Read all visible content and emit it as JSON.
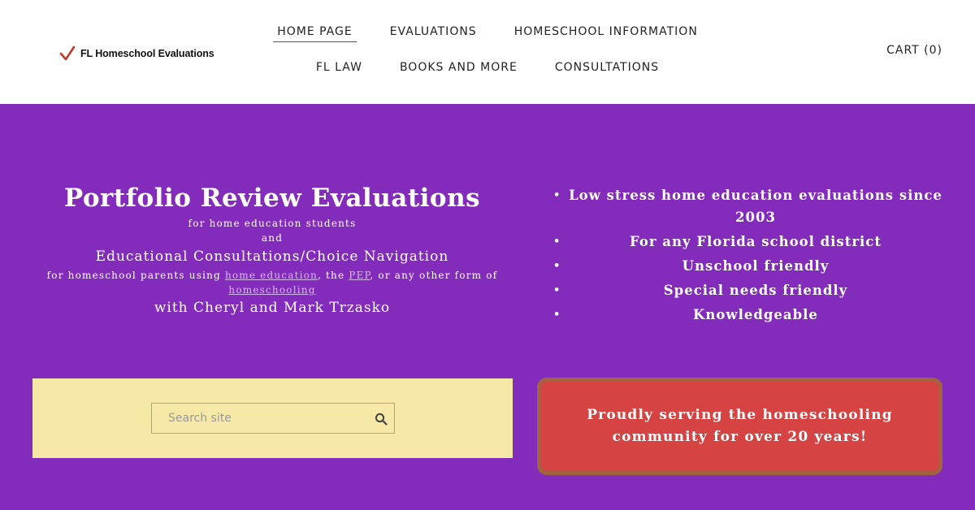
{
  "header": {
    "logo_text": "FL Homeschool Evaluations",
    "nav_row1": [
      {
        "label": "HOME PAGE",
        "active": true
      },
      {
        "label": "EVALUATIONS",
        "active": false
      },
      {
        "label": "HOMESCHOOL INFORMATION",
        "active": false
      }
    ],
    "nav_row2": [
      {
        "label": "FL LAW",
        "active": false
      },
      {
        "label": "BOOKS AND MORE",
        "active": false
      },
      {
        "label": "CONSULTATIONS",
        "active": false
      }
    ],
    "cart": "CART (0)"
  },
  "hero": {
    "title": "Portfolio Review Evaluations",
    "line1": "for home education students",
    "line2": "and",
    "line3": "Educational Consultations/Choice Navigation",
    "line4_prefix": "for homeschool parents using ",
    "link_home_education": "home education",
    "line4_mid1": ", the ",
    "link_pep": "PEP",
    "line4_mid2": ", or any other form of ",
    "link_homeschooling": "homeschooling",
    "people": "with Cheryl and Mark Trzasko",
    "bullets": [
      "Low stress home education evaluations since 2003",
      "For any Florida school district",
      "Unschool friendly",
      "Special needs friendly",
      "Knowledgeable"
    ]
  },
  "search": {
    "placeholder": "Search site"
  },
  "callout": {
    "text": "Proudly serving the homeschooling community for over 20 years!"
  },
  "colors": {
    "background": "#832bbb",
    "search_panel": "#f6e8a6",
    "callout": "#d64343",
    "callout_border": "#a26341",
    "logo_check": "#c0392b"
  }
}
